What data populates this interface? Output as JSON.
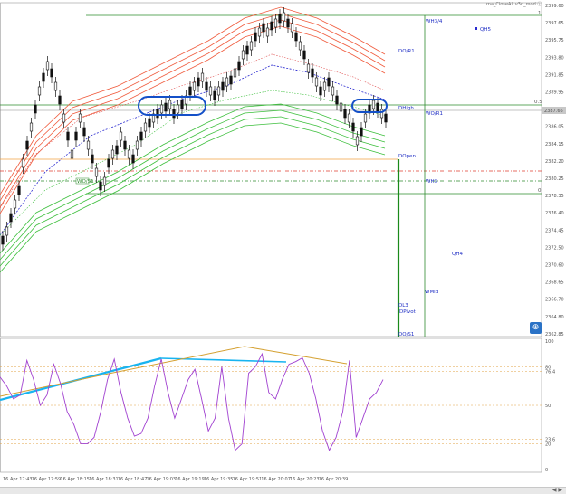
{
  "title": "ma_CloseAll v3d_mod ⓘ",
  "colors": {
    "candle": "#111111",
    "level_green": "#2e8b2e",
    "level_red": "#e03c31",
    "level_orange": "#f0a040",
    "level_blue": "#1f2ec4",
    "band_red": "#f05a3c",
    "band_green": "#3cbf3c",
    "ma_blue": "#2a2ad0",
    "rsi_purple": "#a040d0",
    "trend_cyan": "#18b4f0",
    "trend_orange": "#d4a030",
    "highlight_blue": "#1450c8"
  },
  "price_axis": {
    "ticks": [
      "2399.60",
      "2397.65",
      "2395.75",
      "2393.80",
      "2391.85",
      "2389.95",
      "2388.00",
      "2386.05",
      "2384.15",
      "2382.20",
      "2380.25",
      "2378.35",
      "2376.40",
      "2374.45",
      "2372.50",
      "2370.60",
      "2368.65",
      "2366.70",
      "2364.80",
      "2362.85"
    ],
    "current_price": "2387.66"
  },
  "osc_axis": {
    "ticks": [
      "100",
      "80",
      "76.4",
      "50",
      "23.6",
      "20",
      "0"
    ]
  },
  "time_axis": {
    "ticks": [
      "16 Apr 17:43",
      "16 Apr 17:59",
      "16 Apr 18:15",
      "16 Apr 18:31",
      "16 Apr 18:47",
      "16 Apr 19:03",
      "16 Apr 19:19",
      "16 Apr 19:35",
      "16 Apr 19:51",
      "16 Apr 20:07",
      "16 Apr 20:23",
      "16 Apr 20:39"
    ]
  },
  "levels": {
    "wh34": "WH3/4",
    "qh5": "QH5",
    "dor1": "DO/R1",
    "dhigh": "DHigh",
    "wor1": "WO/R1",
    "dopen": "DOpen",
    "wh3": "WH3",
    "qh4": "QH4",
    "wmid": "WMid",
    "dl3": "DL3",
    "dpivot": "DPivot",
    "dos1": "DO/S1",
    "fib_1": "1",
    "fib_05": "0.5",
    "fib_0": "0",
    "small_box": "WO/S1"
  },
  "chart_data": {
    "type": "candlestick",
    "price_ylim": [
      2362.85,
      2399.6
    ],
    "oscillator_ylim": [
      0,
      100
    ],
    "oscillator_levels": [
      80,
      76.4,
      50,
      23.6,
      20
    ],
    "oscillator": {
      "name": "",
      "values": [
        72,
        65,
        55,
        58,
        85,
        70,
        50,
        58,
        82,
        67,
        45,
        35,
        20,
        20,
        25,
        45,
        70,
        86,
        60,
        40,
        26,
        28,
        40,
        65,
        86,
        60,
        40,
        55,
        70,
        78,
        55,
        30,
        40,
        80,
        40,
        15,
        20,
        75,
        80,
        90,
        60,
        55,
        70,
        82,
        84,
        87,
        75,
        55,
        30,
        15,
        25,
        45,
        85,
        25,
        40,
        55,
        60,
        70
      ]
    }
  }
}
